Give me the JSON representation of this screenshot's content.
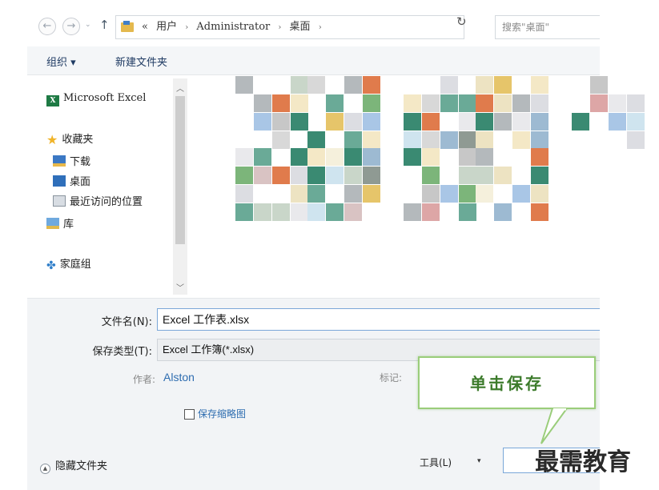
{
  "address_bar": {
    "path": [
      "«",
      "用户",
      "Administrator",
      "桌面"
    ],
    "separator": "›",
    "dropdown_glyph": "∨",
    "refresh_glyph": "↻",
    "search_placeholder": "搜索\"桌面\""
  },
  "nav": {
    "back": "←",
    "forward": "→",
    "up": "↑",
    "history": "⌄"
  },
  "toolbar": {
    "organize": "组织 ▾",
    "new_folder": "新建文件夹"
  },
  "sidebar": {
    "items": [
      {
        "label": "Microsoft Excel",
        "icon": "excel-icon"
      },
      {
        "label": "收藏夹",
        "icon": "star-icon"
      },
      {
        "label": "下载",
        "icon": "downloads-folder-icon"
      },
      {
        "label": "桌面",
        "icon": "desktop-icon"
      },
      {
        "label": "最近访问的位置",
        "icon": "recent-places-icon"
      },
      {
        "label": "库",
        "icon": "library-icon"
      },
      {
        "label": "家庭组",
        "icon": "homegroup-icon"
      }
    ]
  },
  "form": {
    "filename_label": "文件名(N):",
    "filename_value": "Excel 工作表.xlsx",
    "filetype_label": "保存类型(T):",
    "filetype_value": "Excel 工作簿(*.xlsx)",
    "author_label": "作者:",
    "author_value": "Alston",
    "tags_label": "标记:",
    "thumbnail_label": "保存缩略图"
  },
  "footer": {
    "hide_folders": "隐藏文件夹",
    "tools": "工具(L)",
    "tools_dropdown": "▾"
  },
  "callout": {
    "text": "单击保存"
  },
  "watermark": {
    "text": "最需教育"
  },
  "colors": {
    "accent": "#2e6db0",
    "callout_border": "#9acd7a",
    "callout_text": "#3c7b2b"
  }
}
